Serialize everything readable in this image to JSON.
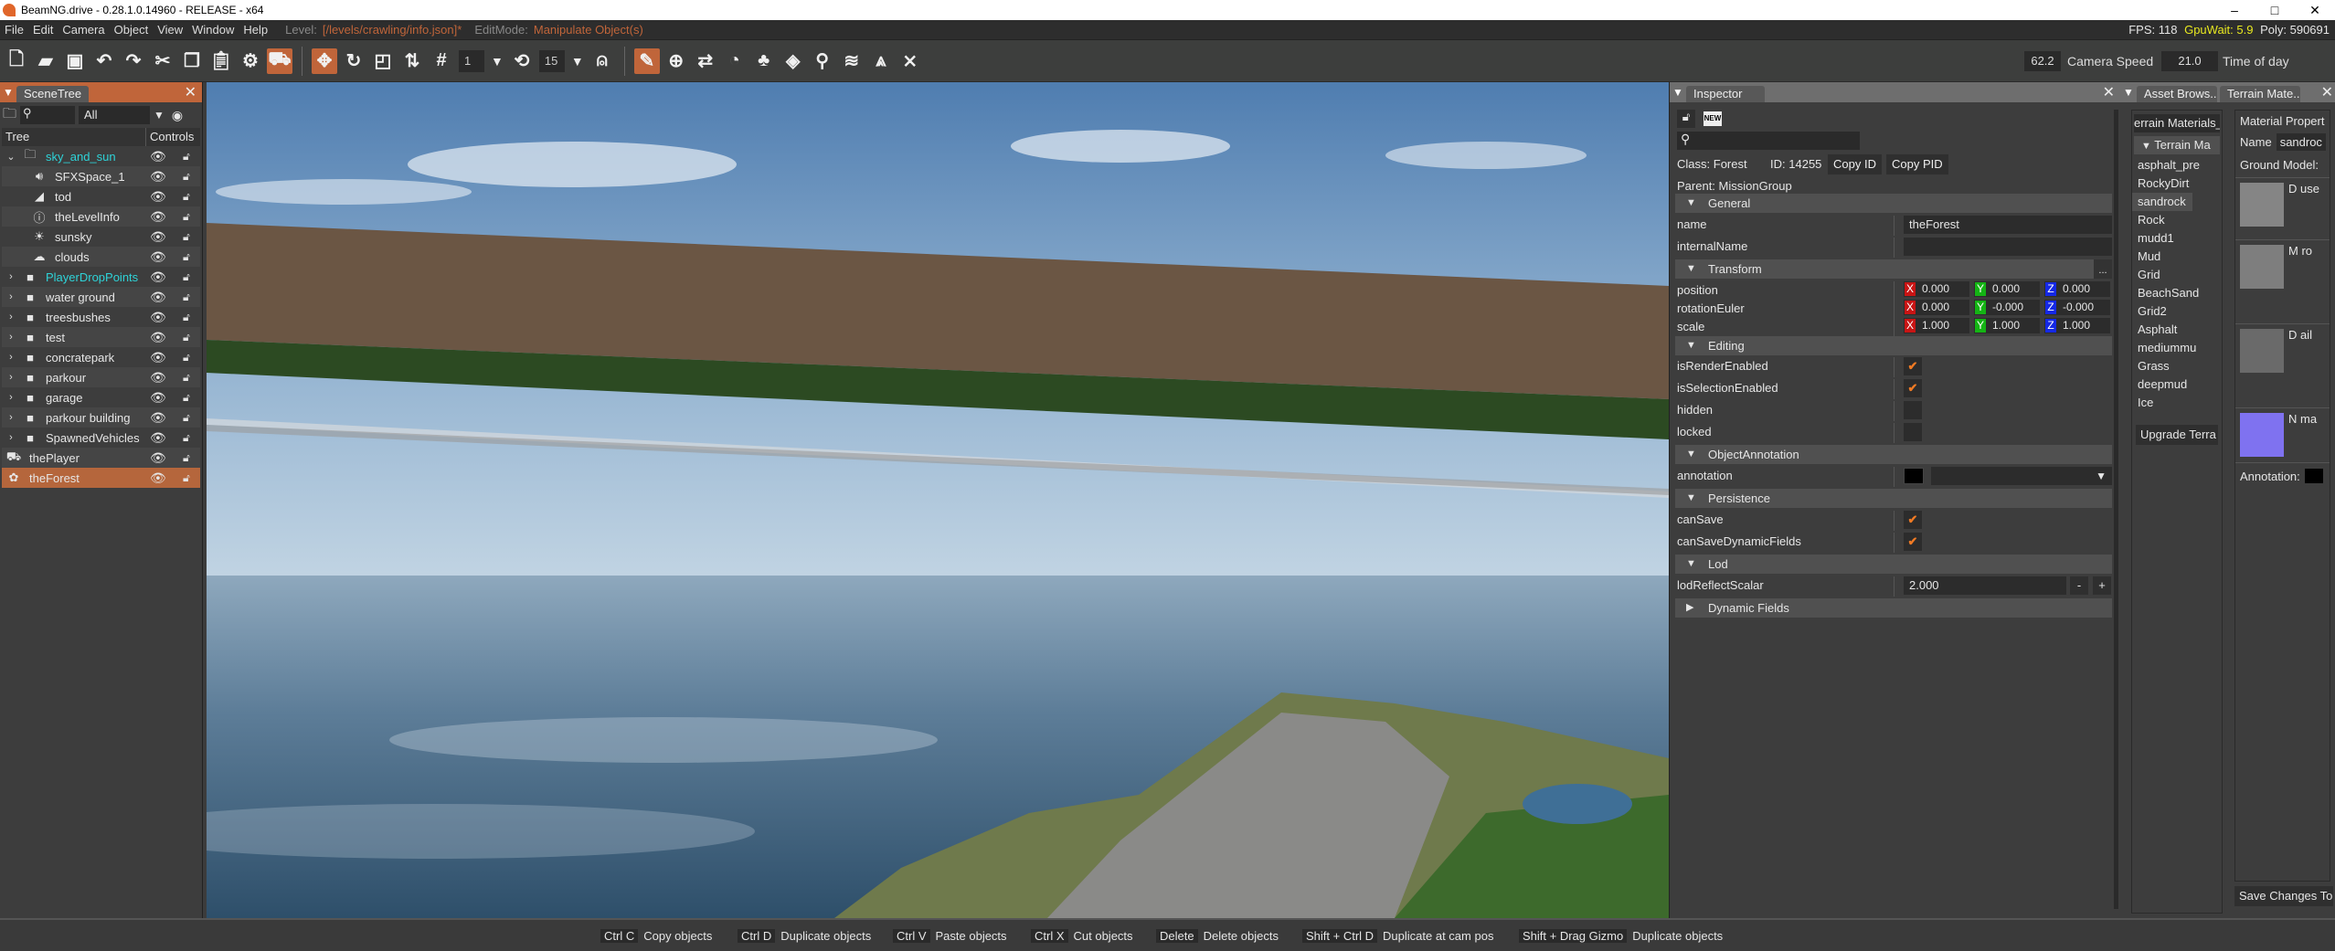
{
  "window": {
    "title": "BeamNG.drive - 0.28.1.0.14960 - RELEASE - x64",
    "minimize": "–",
    "maximize": "□",
    "close": "✕"
  },
  "menu": {
    "items": [
      "File",
      "Edit",
      "Camera",
      "Object",
      "View",
      "Window",
      "Help"
    ],
    "level_label": "Level:",
    "level_value": "[/levels/crawling/info.json]*",
    "editmode_label": "EditMode:",
    "editmode_value": "Manipulate Object(s)"
  },
  "stats": {
    "fps": "FPS: 118",
    "gpuwait": "GpuWait: 5.9",
    "poly": "Poly: 590691",
    "gpuwait_color": "#e8e820"
  },
  "toolbar": {
    "snap_value": "1",
    "rotate_snap_value": "15",
    "camera_speed_value": "62.2",
    "camera_speed_label": "Camera Speed",
    "time_of_day_value": "21.0",
    "time_of_day_label": "Time of day",
    "accent": "#c0653a",
    "icons": [
      "new-file-icon",
      "open-folder-icon",
      "save-icon",
      "undo-icon",
      "redo-icon",
      "cut-icon",
      "copy-icon",
      "paste-icon",
      "settings-icon",
      "vehicle-icon",
      "translate-gizmo-icon",
      "rotate-icon",
      "scale-icon",
      "world-local-icon",
      "grid-snap-icon",
      "rotate-snap-icon",
      "drop-to-ground-icon",
      "edit-pencil-icon",
      "create-object-icon",
      "road-icon",
      "terrain-paint-icon",
      "forest-icon",
      "decal-icon",
      "spawn-point-icon",
      "river-icon",
      "road-lanes-icon",
      "mesh-tools-icon"
    ]
  },
  "scenetree": {
    "tab": "SceneTree",
    "filter_value": "All",
    "col_tree": "Tree",
    "col_controls": "Controls",
    "items": [
      {
        "name": "sky_and_sun",
        "icon": "folder-open-icon",
        "arrow": "⌄",
        "color": "#2ed3d8",
        "indent": 0
      },
      {
        "name": "SFXSpace_1",
        "icon": "speaker-icon",
        "arrow": "",
        "color": "#e6e6e6",
        "indent": 1
      },
      {
        "name": "tod",
        "icon": "time-of-day-icon",
        "arrow": "",
        "color": "#e6e6e6",
        "indent": 1
      },
      {
        "name": "theLevelInfo",
        "icon": "info-icon",
        "arrow": "",
        "color": "#e6e6e6",
        "indent": 1
      },
      {
        "name": "sunsky",
        "icon": "sun-sky-icon",
        "arrow": "",
        "color": "#e6e6e6",
        "indent": 1
      },
      {
        "name": "clouds",
        "icon": "cloud-icon",
        "arrow": "",
        "color": "#e6e6e6",
        "indent": 1
      },
      {
        "name": "PlayerDropPoints",
        "icon": "folder-icon",
        "arrow": "›",
        "color": "#2ed3d8",
        "indent": 0
      },
      {
        "name": "water ground",
        "icon": "folder-icon",
        "arrow": "›",
        "color": "#e6e6e6",
        "indent": 0
      },
      {
        "name": "treesbushes",
        "icon": "folder-icon",
        "arrow": "›",
        "color": "#e6e6e6",
        "indent": 0
      },
      {
        "name": "test",
        "icon": "folder-icon",
        "arrow": "›",
        "color": "#e6e6e6",
        "indent": 0
      },
      {
        "name": "concratepark",
        "icon": "folder-icon",
        "arrow": "›",
        "color": "#e6e6e6",
        "indent": 0
      },
      {
        "name": "parkour",
        "icon": "folder-icon",
        "arrow": "›",
        "color": "#e6e6e6",
        "indent": 0
      },
      {
        "name": "garage",
        "icon": "folder-icon",
        "arrow": "›",
        "color": "#e6e6e6",
        "indent": 0
      },
      {
        "name": "parkour building",
        "icon": "folder-icon",
        "arrow": "›",
        "color": "#e6e6e6",
        "indent": 0
      },
      {
        "name": "SpawnedVehicles",
        "icon": "folder-icon",
        "arrow": "›",
        "color": "#e6e6e6",
        "indent": 0
      },
      {
        "name": "thePlayer",
        "icon": "car-icon",
        "arrow": "",
        "color": "#e6e6e6",
        "indent": -1
      },
      {
        "name": "theForest",
        "icon": "forest-icon",
        "arrow": "",
        "color": "#e6e6e6",
        "indent": -1,
        "selected": true
      }
    ]
  },
  "inspector": {
    "tab": "Inspector",
    "new_badge": "NEW",
    "class_label": "Class:",
    "class_value": "Forest",
    "id_label": "ID:",
    "id_value": "14255",
    "copy_id": "Copy ID",
    "copy_pid": "Copy PID",
    "parent_label": "Parent:",
    "parent_value": "MissionGroup",
    "sections": {
      "general": "General",
      "transform": "Transform",
      "editing": "Editing",
      "annotation": "ObjectAnnotation",
      "persistence": "Persistence",
      "lod": "Lod",
      "dynamic": "Dynamic Fields"
    },
    "transform_more": "...",
    "fields": {
      "name_label": "name",
      "name_value": "theForest",
      "internal_label": "internalName",
      "internal_value": "",
      "position_label": "position",
      "position": [
        "0.000",
        "0.000",
        "0.000"
      ],
      "rotation_label": "rotationEuler",
      "rotation": [
        "0.000",
        "-0.000",
        "-0.000"
      ],
      "scale_label": "scale",
      "scale": [
        "1.000",
        "1.000",
        "1.000"
      ],
      "axes": [
        "X",
        "Y",
        "Z"
      ],
      "axis_colors": [
        "#c81414",
        "#14b414",
        "#1428e6"
      ],
      "isRenderEnabled_label": "isRenderEnabled",
      "isRenderEnabled": true,
      "isSelectionEnabled_label": "isSelectionEnabled",
      "isSelectionEnabled": true,
      "hidden_label": "hidden",
      "hidden": false,
      "locked_label": "locked",
      "locked": false,
      "annotation_label": "annotation",
      "annotation_color": "#000000",
      "canSave_label": "canSave",
      "canSave": true,
      "canSaveDynamic_label": "canSaveDynamicFields",
      "canSaveDynamic": true,
      "lod_label": "lodReflectScalar",
      "lod_value": "2.000",
      "minus": "-",
      "plus": "+",
      "check": "✔"
    }
  },
  "assets": {
    "tab1": "Asset Brows...",
    "tab2": "Terrain Mate...",
    "list_title": "errain Materials_",
    "tree_header": "Terrain Ma",
    "materials": [
      "asphalt_pre",
      "RockyDirt",
      "sandrock",
      "Rock",
      "mudd1",
      "Mud",
      "Grid",
      "BeachSand",
      "Grid2",
      "Asphalt",
      "mediummu",
      "Grass",
      "deepmud",
      "Ice"
    ],
    "selected": "sandrock",
    "upgrade": "Upgrade Terra",
    "props_title": "Material Propert",
    "name_label": "Name",
    "name_value": "sandroc",
    "ground_model": "Ground Model:",
    "maps": [
      "D  use",
      "M  ro",
      "D  ail",
      "N  ma"
    ],
    "annotation": "Annotation:",
    "save": "Save Changes To"
  },
  "shortcuts": [
    {
      "key": "Ctrl C",
      "label": "Copy objects"
    },
    {
      "key": "Ctrl D",
      "label": "Duplicate objects"
    },
    {
      "key": "Ctrl V",
      "label": "Paste objects"
    },
    {
      "key": "Ctrl X",
      "label": "Cut objects"
    },
    {
      "key": "Delete",
      "label": "Delete objects"
    },
    {
      "key": "Shift + Ctrl D",
      "label": "Duplicate at cam pos"
    },
    {
      "key": "Shift + Drag Gizmo",
      "label": "Duplicate objects"
    }
  ]
}
